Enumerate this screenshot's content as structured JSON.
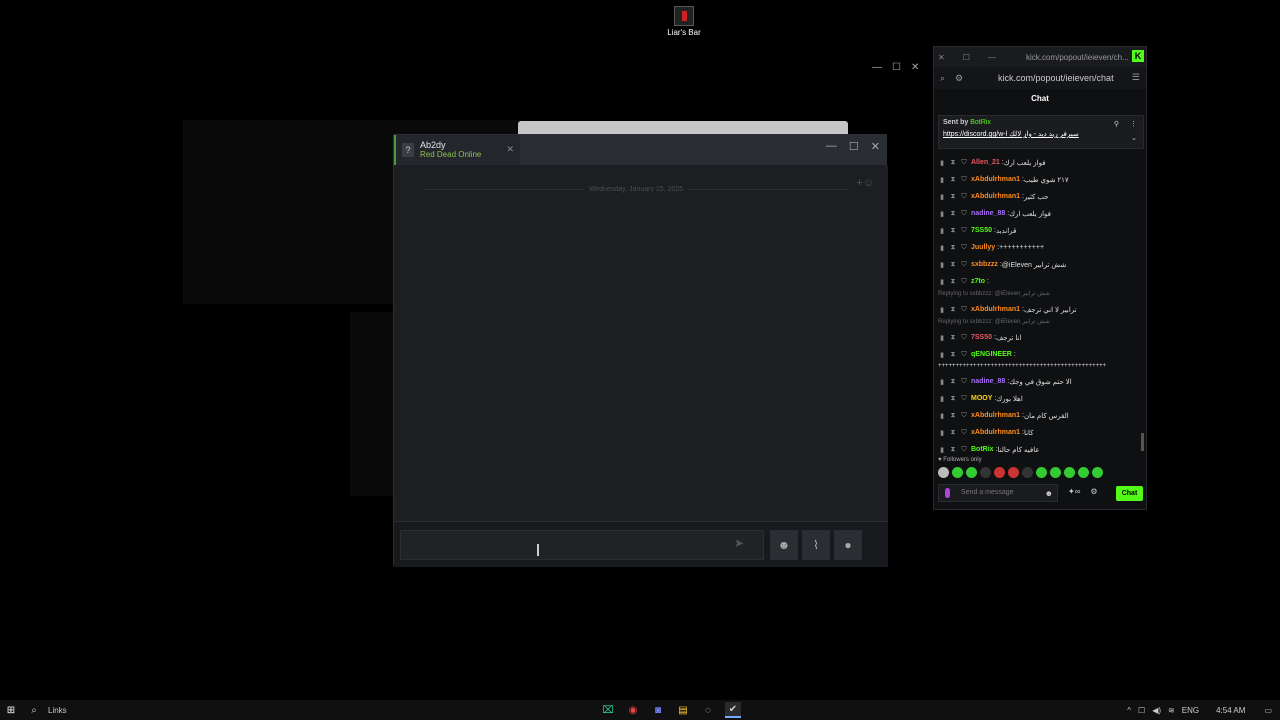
{
  "desktop": {
    "icon_label": "Liar's Bar"
  },
  "steam_chat": {
    "friend_name": "Ab2dy",
    "friend_game": "Red Dead Online",
    "date_separator": "Wednesday, January 15, 2025",
    "input_placeholder": ""
  },
  "kick": {
    "title_url": "kick.com/popout/ieieven/ch...",
    "address_url": "kick.com/popout/ieieven/chat",
    "chat_title": "Chat",
    "pinned": {
      "sent_by": "Sent by",
      "bot_name": "BotRix",
      "link": "https://discord.gg/w-l",
      "link_text": "سيرفر ريد ديد - واز لالك"
    },
    "messages": [
      {
        "user": "Allen_21",
        "text": "فواز يلعب ارك",
        "color": "#e8575f"
      },
      {
        "user": "xAbdulrhman1",
        "text": "٢١٧ شوي طيب",
        "color": "#ff8c1a"
      },
      {
        "user": "xAbdulrhman1",
        "text": "حب كثير",
        "color": "#ff8c1a"
      },
      {
        "user": "nadine_88",
        "text": "فواز يلعب ارك",
        "color": "#a46cf5"
      },
      {
        "user": "7SS50",
        "text": "قرانديد",
        "color": "#53fc18"
      },
      {
        "user": "Juullyy",
        "text": "+++++++++++",
        "color": "#ff8c1a"
      },
      {
        "user": "sxbbzzz",
        "text": "@iEleven شش ترابير",
        "color": "#ff8c1a"
      },
      {
        "user": "z7to",
        "text": "",
        "color": "#53fc18"
      }
    ],
    "reply_1": "Replying to sxbbzzz: @iEleven شش ترابير",
    "reply_msg_1": {
      "user": "xAbdulrhman1",
      "text": "ترابير لا اني ترجف",
      "color": "#ff8c1a"
    },
    "reply_2": "Replying to sxbbzzz: @iEleven شش ترابير",
    "reply_msg_2": {
      "user": "7SS50",
      "text": "انا ترجف",
      "color": "#e8575f"
    },
    "engineer": {
      "user": "qENGINEER",
      "text": "",
      "color": "#53fc18"
    },
    "long_line": "++++++++++++++++++++++++++++++++++++++++++++++++",
    "messages_2": [
      {
        "user": "nadine_88",
        "text": "الا حتم شوق في وجك",
        "color": "#a46cf5"
      },
      {
        "user": "MOOY",
        "text": "اهلا بورك",
        "color": "#ffd21a"
      },
      {
        "user": "xAbdulrhman1",
        "text": "القرس كام مان",
        "color": "#ff8c1a"
      },
      {
        "user": "xAbdulrhman1",
        "text": "كانا",
        "color": "#ff8c1a"
      },
      {
        "user": "BotRix",
        "text": "عافيه كام حالنا",
        "color": "#53fc18"
      }
    ],
    "followers_only": "Followers only",
    "input_placeholder": "Send a message",
    "chat_button": "Chat"
  },
  "taskbar": {
    "search_label": "Links",
    "language": "ENG",
    "time": "4:54 AM"
  }
}
